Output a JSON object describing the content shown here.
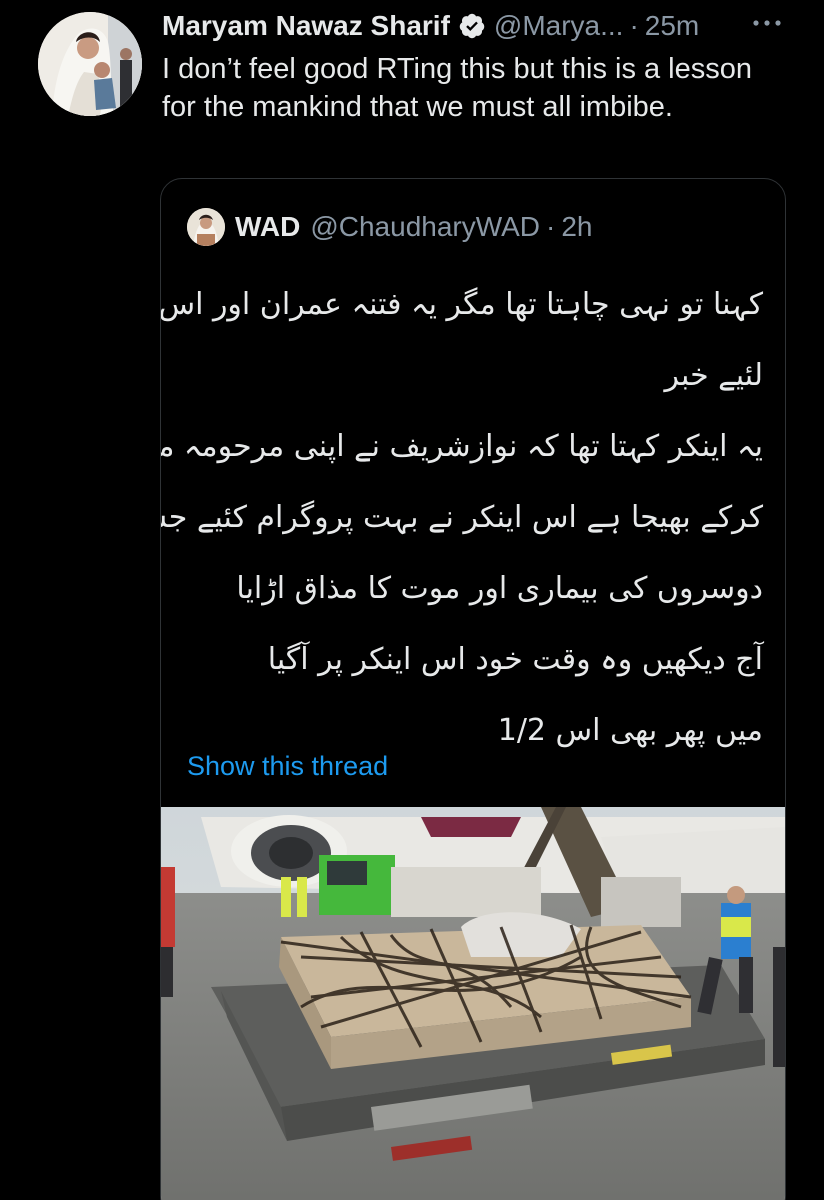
{
  "tweet": {
    "author_name": "Maryam Nawaz Sharif",
    "handle": "@Marya...",
    "separator": "·",
    "time": "25m",
    "more_glyph": "···",
    "text": "I don’t feel good RTing this but this is a lesson for the mankind that we must all imbibe."
  },
  "quoted": {
    "author_name": "WAD",
    "handle": "@ChaudharyWAD",
    "separator": "·",
    "time": "2h",
    "lines": [
      "کہنا تو نہی چاہتا تھا مگر یہ فتنہ عمران اور اس کے یوتھیوں کے",
      "لئیے خبر",
      "یہ اینکر کہتا تھا کہ نوازشریف نے اپنی مرحومہ ماں کو پارسل",
      "کرکے بھیجا ہے اس اینکر نے بہت پروگرام کئیے جس میں",
      "دوسروں کی بیماری اور موت کا مذاق اڑایا",
      "آج دیکھیں  وہ وقت خود اس اینکر پر آگیا",
      "میں پھر بھی اس 1/2"
    ],
    "show_thread": "Show this thread"
  },
  "colors": {
    "background": "#000000",
    "text": "#e7e9ea",
    "muted": "#8b98a5",
    "link": "#1d9bf0",
    "border": "#2f3336"
  },
  "icons": [
    "verified-badge-icon",
    "more-icon"
  ]
}
